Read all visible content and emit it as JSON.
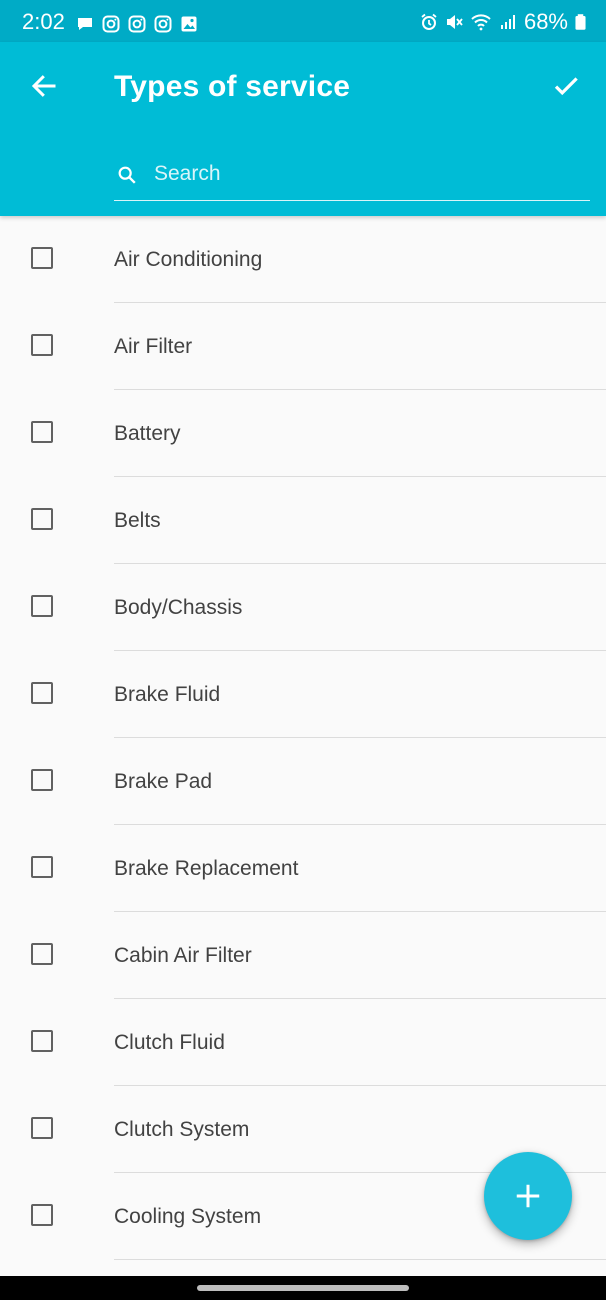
{
  "status_bar": {
    "time": "2:02",
    "battery": "68%",
    "left_icons": [
      "chat-icon",
      "instagram-icon",
      "instagram-icon",
      "instagram-icon",
      "gallery-icon"
    ],
    "right_icons": [
      "alarm-icon",
      "mute-icon",
      "wifi-icon",
      "signal-icon",
      "battery-icon"
    ]
  },
  "app_bar": {
    "title": "Types of service",
    "back_icon": "arrow-back-icon",
    "confirm_icon": "check-icon",
    "color": "#00bcd6"
  },
  "search": {
    "placeholder": "Search",
    "value": ""
  },
  "service_types": [
    {
      "label": "Air Conditioning",
      "checked": false
    },
    {
      "label": "Air Filter",
      "checked": false
    },
    {
      "label": "Battery",
      "checked": false
    },
    {
      "label": "Belts",
      "checked": false
    },
    {
      "label": "Body/Chassis",
      "checked": false
    },
    {
      "label": "Brake Fluid",
      "checked": false
    },
    {
      "label": "Brake Pad",
      "checked": false
    },
    {
      "label": "Brake Replacement",
      "checked": false
    },
    {
      "label": "Cabin Air Filter",
      "checked": false
    },
    {
      "label": "Clutch Fluid",
      "checked": false
    },
    {
      "label": "Clutch System",
      "checked": false
    },
    {
      "label": "Cooling System",
      "checked": false
    }
  ],
  "fab": {
    "icon": "plus-icon",
    "color": "#1ebfdc"
  }
}
